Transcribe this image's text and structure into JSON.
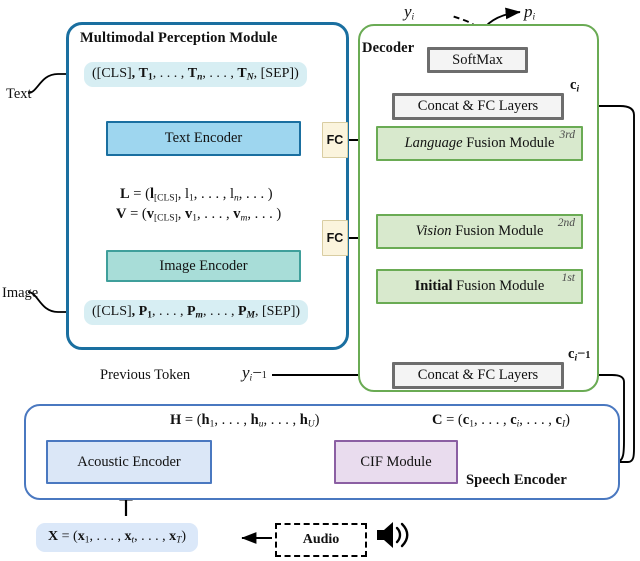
{
  "figure": {
    "type": "architecture-diagram",
    "title": "Multimodal speech-translation model architecture"
  },
  "perception": {
    "title": "Multimodal Perception Module",
    "text_input_label": "Text",
    "image_input_label": "Image",
    "text_tokens": "([CLS], T₁, . . . , Tₙ, . . . , T_N, [SEP])",
    "image_tokens": "([CLS], P₁, . . . , P_m, . . . , P_M, [SEP])",
    "text_encoder": "Text Encoder",
    "image_encoder": "Image Encoder",
    "L_formula": "L = (l[CLS], l₁, . . . , lₙ, . . . )",
    "V_formula": "V = (v[CLS], v₁, . . . , v_m, . . . )",
    "fc_top": "FC",
    "fc_bottom": "FC"
  },
  "decoder": {
    "title": "Decoder",
    "softmax": "SoftMax",
    "concat_top": "Concat & FC Layers",
    "concat_bottom": "Concat & FC Layers",
    "fusion_modules": [
      {
        "emph": "Language",
        "rest": " Fusion Module",
        "order": "3rd"
      },
      {
        "emph": "Vision",
        "rest": " Fusion Module",
        "order": "2nd"
      },
      {
        "emph": "Initial",
        "rest": " Fusion Module",
        "order": "1st"
      }
    ],
    "output_token": "yᵢ",
    "output_prob": "pᵢ",
    "context_top": "cᵢ",
    "context_bottom": "cᵢ₋₁",
    "previous_token_label": "Previous Token",
    "previous_token_symbol": "yᵢ₋₁"
  },
  "speech": {
    "title": "Speech Encoder",
    "acoustic_encoder": "Acoustic Encoder",
    "cif_module": "CIF Module",
    "H_formula": "H = (h₁, . . . , h_u, . . . , h_U)",
    "C_formula": "C = (c₁, . . . , cᵢ, . . . , c_I)",
    "X_formula": "X = (x₁, . . . , x_t, . . . , x_T)",
    "audio_label": "Audio",
    "speaker_icon": "speaker-icon"
  },
  "colors": {
    "perception_border": "#1a6fa0",
    "decoder_border": "#6aab54",
    "speech_border": "#4a78c0",
    "text_encoder_fill": "#9ed6ef",
    "image_encoder_fill": "#a8ddd8",
    "fusion_fill": "#d8e9cd",
    "gray_box_fill": "#f4f4f4",
    "fc_fill": "#fbf4dd",
    "acoustic_fill": "#dbe7f7",
    "cif_fill": "#e9dcee",
    "token_teal": "#d7eef3",
    "token_blue": "#dbe8f9"
  }
}
